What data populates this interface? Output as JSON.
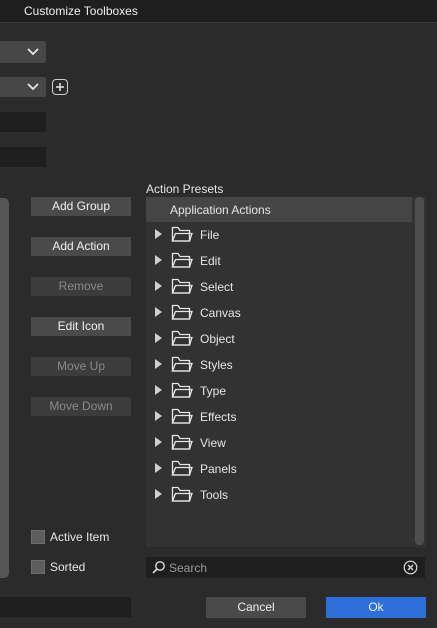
{
  "window": {
    "title": "Customize Toolboxes"
  },
  "buttons": {
    "add_group": "Add Group",
    "add_action": "Add Action",
    "remove": "Remove",
    "edit_icon": "Edit Icon",
    "move_up": "Move Up",
    "move_down": "Move Down"
  },
  "checkboxes": {
    "active_item": {
      "label": "Active Item",
      "checked": false
    },
    "sorted": {
      "label": "Sorted",
      "checked": false
    }
  },
  "presets": {
    "label": "Action Presets",
    "root": "Application Actions",
    "items": [
      "File",
      "Edit",
      "Select",
      "Canvas",
      "Object",
      "Styles",
      "Type",
      "Effects",
      "View",
      "Panels",
      "Tools"
    ]
  },
  "search": {
    "placeholder": "Search"
  },
  "footer": {
    "cancel": "Cancel",
    "ok": "Ok"
  },
  "icons": {
    "add": "plus-square-icon",
    "dropdown": "chevron-down-icon",
    "expand": "triangle-right-icon",
    "folder": "folder-icon",
    "search": "magnifier-icon",
    "clear": "circle-x-icon"
  },
  "colors": {
    "background": "#2b2b2b",
    "panel": "#323232",
    "button": "#4a4a4a",
    "primary": "#2f6fd9",
    "field": "#1e1e1e"
  }
}
